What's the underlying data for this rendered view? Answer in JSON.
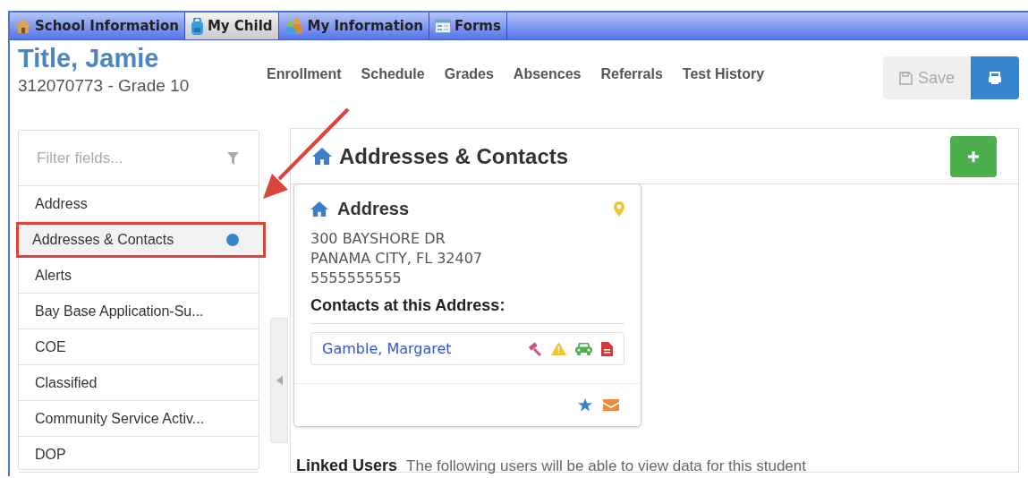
{
  "top_tabs": [
    {
      "label": "School Information",
      "selected": false
    },
    {
      "label": "My Child",
      "selected": true
    },
    {
      "label": "My Information",
      "selected": false
    },
    {
      "label": "Forms",
      "selected": false
    }
  ],
  "student": {
    "name": "Title, Jamie",
    "subtitle": "312070773 - Grade 10"
  },
  "nav_links": [
    "Enrollment",
    "Schedule",
    "Grades",
    "Absences",
    "Referrals",
    "Test History"
  ],
  "toolbar": {
    "save_label": "Save",
    "save_disabled": true
  },
  "sidebar": {
    "filter_placeholder": "Filter fields...",
    "items": [
      {
        "label": "Address",
        "selected": false,
        "dot": false,
        "highlighted": false
      },
      {
        "label": "Addresses & Contacts",
        "selected": true,
        "dot": true,
        "highlighted": true
      },
      {
        "label": "Alerts",
        "selected": false,
        "dot": false,
        "highlighted": false
      },
      {
        "label": "Bay Base Application-Su...",
        "selected": false,
        "dot": false,
        "highlighted": false
      },
      {
        "label": "COE",
        "selected": false,
        "dot": false,
        "highlighted": false
      },
      {
        "label": "Classified",
        "selected": false,
        "dot": false,
        "highlighted": false
      },
      {
        "label": "Community Service Activ...",
        "selected": false,
        "dot": false,
        "highlighted": false
      },
      {
        "label": "DOP",
        "selected": false,
        "dot": false,
        "highlighted": false
      }
    ]
  },
  "panel": {
    "title": "Addresses & Contacts",
    "address_card": {
      "title": "Address",
      "lines": [
        "300 BAYSHORE DR",
        "PANAMA CITY, FL 32407",
        "5555555555"
      ],
      "contacts_heading": "Contacts at this Address:",
      "contacts": [
        {
          "name": "Gamble, Margaret"
        }
      ]
    },
    "linked_users": {
      "title": "Linked Users",
      "description": "The following users will be able to view data for this student"
    }
  }
}
